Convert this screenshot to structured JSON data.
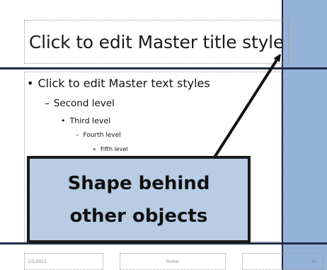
{
  "slide": {
    "title": "Click to edit Master title style",
    "body_levels": [
      {
        "marker": "•",
        "text": "Click to edit Master text styles"
      },
      {
        "marker": "–",
        "text": "Second level"
      },
      {
        "marker": "•",
        "text": "Third level"
      },
      {
        "marker": "–",
        "text": "Fourth level"
      },
      {
        "marker": "»",
        "text": "Fifth level"
      }
    ],
    "footer": {
      "date": "1/1/2013",
      "center": "Footer",
      "number": "‹#›"
    }
  },
  "callout": {
    "line1": "Shape behind",
    "line2": "other objects"
  },
  "colors": {
    "band": "#95b3d7",
    "callout_fill": "#b8cce4",
    "line": "#1f2d4d"
  }
}
